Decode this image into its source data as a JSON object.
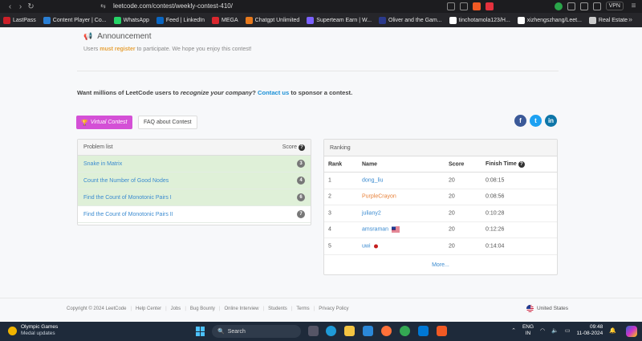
{
  "browser": {
    "url": "leetcode.com/contest/weekly-contest-410/",
    "vpn_label": "VPN",
    "bookmarks": [
      {
        "label": "LastPass",
        "color": "#cc2029"
      },
      {
        "label": "Content Player | Co...",
        "color": "#2a7fd4"
      },
      {
        "label": "WhatsApp",
        "color": "#25d366"
      },
      {
        "label": "Feed | LinkedIn",
        "color": "#0a66c2"
      },
      {
        "label": "MEGA",
        "color": "#d9272e"
      },
      {
        "label": "Chatgpt Unlimited",
        "color": "#e87a1d"
      },
      {
        "label": "Superteam Earn | W...",
        "color": "#7b61ff"
      },
      {
        "label": "Oliver and the Gam...",
        "color": "#2b3a8c"
      },
      {
        "label": "tinchotamola123/H...",
        "color": "#ffffff"
      },
      {
        "label": "xizhengszhang/Leet...",
        "color": "#ffffff"
      },
      {
        "label": "Real Estate",
        "color": "#cccccc"
      }
    ]
  },
  "announcement": {
    "title": "Announcement",
    "text_before": "Users ",
    "emphasis": "must register",
    "text_after": " to participate. We hope you enjoy this contest!"
  },
  "sponsor": {
    "text_before": "Want millions of LeetCode users to ",
    "emphasis": "recognize your company",
    "text_middle": "? ",
    "link": "Contact us",
    "text_after": " to sponsor a contest."
  },
  "buttons": {
    "virtual_contest": "Virtual Contest",
    "faq": "FAQ about Contest"
  },
  "problems": {
    "header_title": "Problem list",
    "header_score": "Score",
    "items": [
      {
        "name": "Snake in Matrix",
        "score": "3",
        "solved": true
      },
      {
        "name": "Count the Number of Good Nodes",
        "score": "4",
        "solved": true
      },
      {
        "name": "Find the Count of Monotonic Pairs I",
        "score": "6",
        "solved": true
      },
      {
        "name": "Find the Count of Monotonic Pairs II",
        "score": "7",
        "solved": false
      }
    ]
  },
  "ranking": {
    "title": "Ranking",
    "columns": {
      "rank": "Rank",
      "name": "Name",
      "score": "Score",
      "time": "Finish Time"
    },
    "rows": [
      {
        "rank": "1",
        "name": "dong_liu",
        "name_color": "#3b8bd0",
        "score": "20",
        "time": "0:08:15",
        "flag": ""
      },
      {
        "rank": "2",
        "name": "PurpleCrayon",
        "name_color": "#e8823a",
        "score": "20",
        "time": "0:08:56",
        "flag": ""
      },
      {
        "rank": "3",
        "name": "juliany2",
        "name_color": "#3b8bd0",
        "score": "20",
        "time": "0:10:28",
        "flag": ""
      },
      {
        "rank": "4",
        "name": "amsraman",
        "name_color": "#3b8bd0",
        "score": "20",
        "time": "0:12:26",
        "flag": "us"
      },
      {
        "rank": "5",
        "name": "uwi",
        "name_color": "#3b8bd0",
        "score": "20",
        "time": "0:14:04",
        "flag": "jp"
      }
    ],
    "more": "More..."
  },
  "footer": {
    "copyright": "Copyright © 2024 LeetCode",
    "links": [
      "Help Center",
      "Jobs",
      "Bug Bounty",
      "Online Interview",
      "Students",
      "Terms",
      "Privacy Policy"
    ],
    "region": "United States"
  },
  "taskbar": {
    "weather_title": "Olympic Games",
    "weather_sub": "Medal updates",
    "search_placeholder": "Search",
    "lang_top": "ENG",
    "lang_bottom": "IN",
    "time": "09:48",
    "date": "11-08-2024"
  }
}
